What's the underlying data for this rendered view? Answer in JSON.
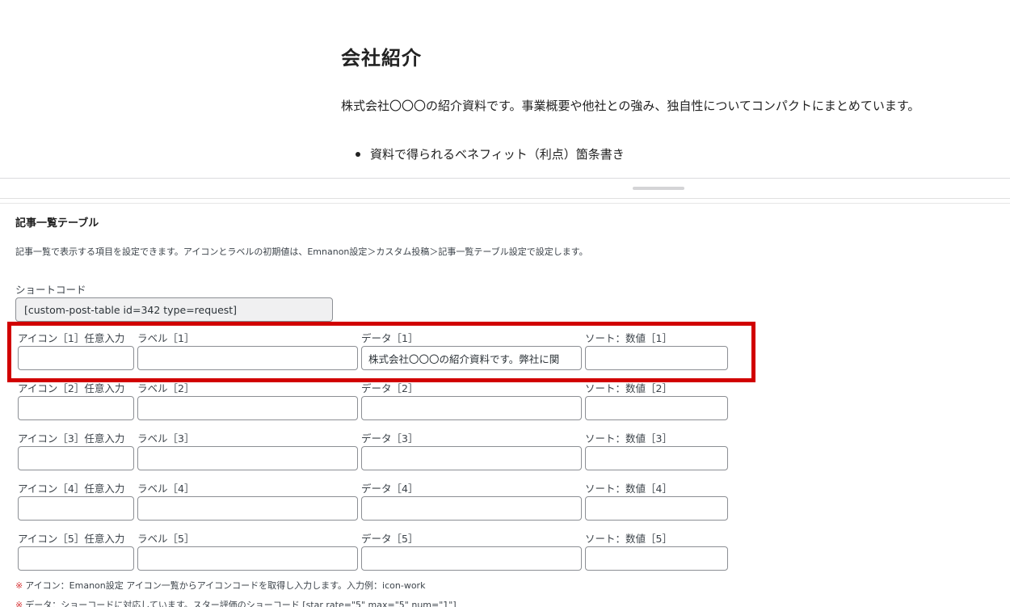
{
  "preview": {
    "title": "会社紹介",
    "description": "株式会社〇〇〇の紹介資料です。事業概要や他社との強み、独自性についてコンパクトにまとめています。",
    "list_items": [
      "資料で得られるベネフィット（利点）箇条書き"
    ]
  },
  "metabox": {
    "title": "記事一覧テーブル",
    "description": "記事一覧で表示する項目を設定できます。アイコンとラベルの初期値は、Emnanon設定＞カスタム投稿＞記事一覧テーブル設定で設定します。",
    "shortcode": {
      "label": "ショートコード",
      "value": "[custom-post-table id=342 type=request]"
    },
    "rows": [
      {
        "icon_label": "アイコン［1］任意入力",
        "label_label": "ラベル［1］",
        "data_label": "データ［1］",
        "sort_label": "ソート：数値［1］",
        "icon_value": "",
        "label_value": "",
        "data_value": "株式会社〇〇〇の紹介資料です。弊社に関",
        "sort_value": ""
      },
      {
        "icon_label": "アイコン［2］任意入力",
        "label_label": "ラベル［2］",
        "data_label": "データ［2］",
        "sort_label": "ソート：数値［2］",
        "icon_value": "",
        "label_value": "",
        "data_value": "",
        "sort_value": ""
      },
      {
        "icon_label": "アイコン［3］任意入力",
        "label_label": "ラベル［3］",
        "data_label": "データ［3］",
        "sort_label": "ソート：数値［3］",
        "icon_value": "",
        "label_value": "",
        "data_value": "",
        "sort_value": ""
      },
      {
        "icon_label": "アイコン［4］任意入力",
        "label_label": "ラベル［4］",
        "data_label": "データ［4］",
        "sort_label": "ソート：数値［4］",
        "icon_value": "",
        "label_value": "",
        "data_value": "",
        "sort_value": ""
      },
      {
        "icon_label": "アイコン［5］任意入力",
        "label_label": "ラベル［5］",
        "data_label": "データ［5］",
        "sort_label": "ソート：数値［5］",
        "icon_value": "",
        "label_value": "",
        "data_value": "",
        "sort_value": ""
      }
    ],
    "notes": [
      {
        "mark": "※",
        "text": "アイコン：Emanon設定 アイコン一覧からアイコンコードを取得し入力します。入力例：icon-work"
      },
      {
        "mark": "※",
        "text": "データ：ショーコードに対応しています。スター評価のショーコード [star rate=\"5\" max=\"5\" num=\"1\"]"
      }
    ]
  },
  "colors": {
    "highlight": "#d10000",
    "note_mark": "#d63638",
    "input_border": "#8c8f94",
    "readonly_bg": "#f0f0f1"
  }
}
